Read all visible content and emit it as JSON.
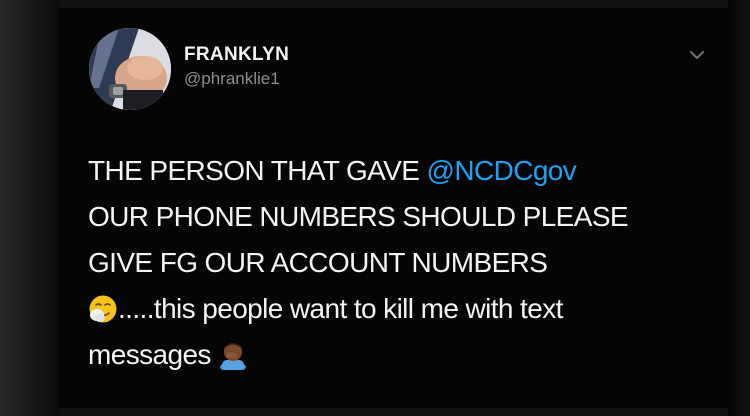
{
  "tweet": {
    "author_name": "FRANKLYN",
    "author_handle": "@phranklie1",
    "line1_text": "THE PERSON THAT GAVE ",
    "mention": "@NCDCgov",
    "line2": "OUR PHONE NUMBERS SHOULD PLEASE",
    "line3": "GIVE FG OUR ACCOUNT NUMBERS",
    "line4_text": ".....this people want to kill me with text",
    "line5_text": "messages",
    "emojis": [
      "sneezing-face-emoji",
      "facepalm-emoji"
    ]
  },
  "icons": {
    "more_menu": "chevron-down-icon"
  },
  "colors": {
    "background": "#050506",
    "text": "#f4f4f4",
    "handle": "#8a8d91",
    "mention": "#1da1f2"
  }
}
